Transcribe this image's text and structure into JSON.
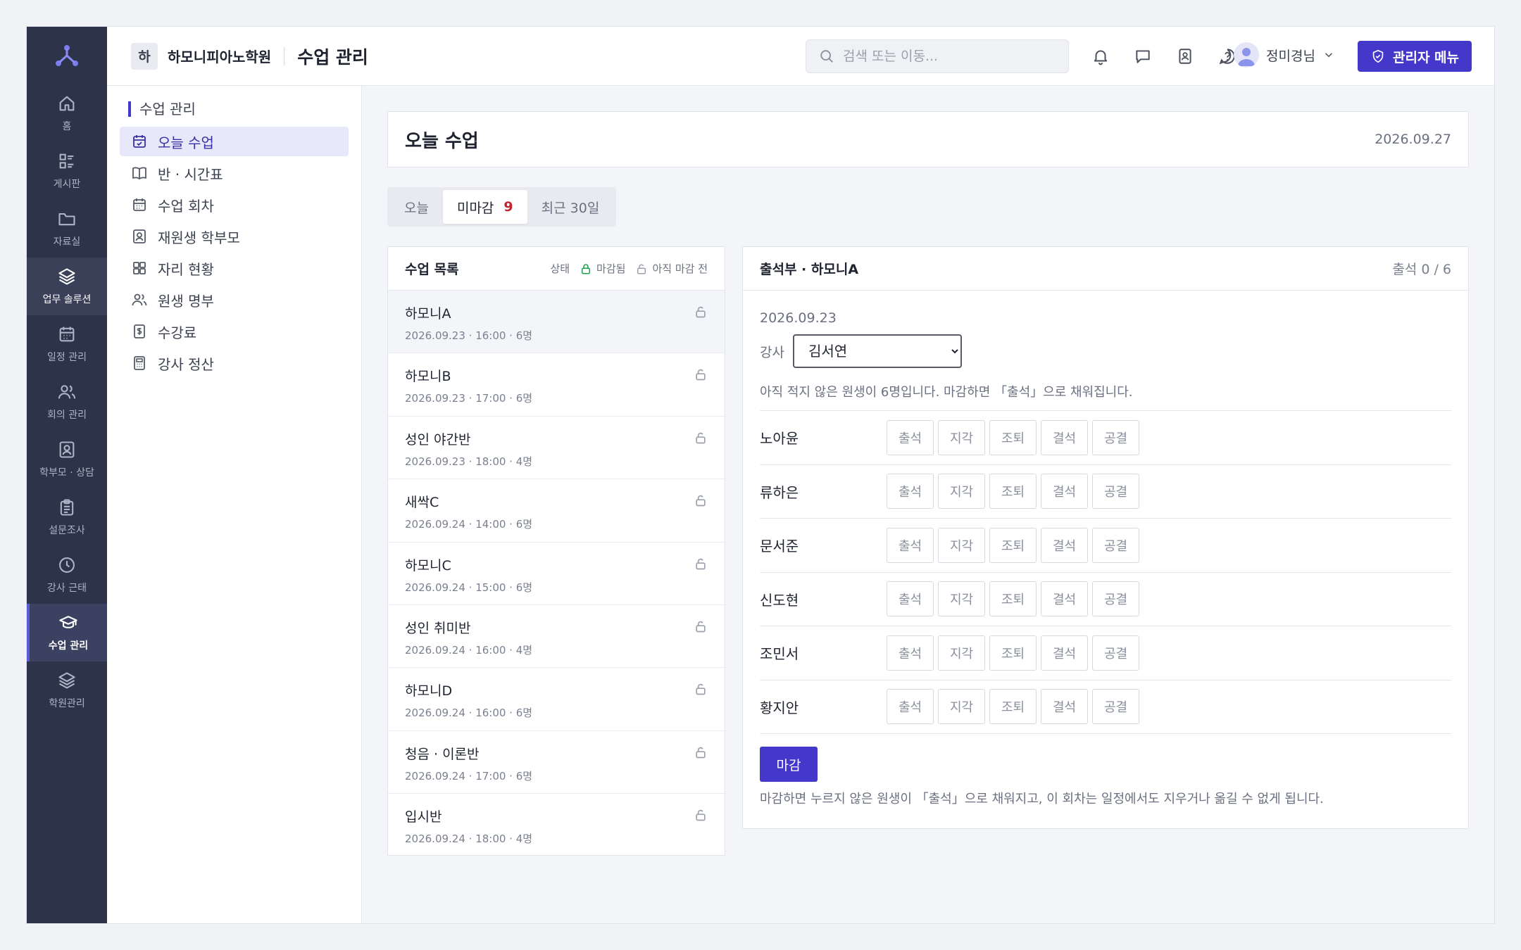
{
  "rail": {
    "items": [
      {
        "label": "홈",
        "icon": "home-icon"
      },
      {
        "label": "게시판",
        "icon": "board-icon"
      },
      {
        "label": "자료실",
        "icon": "folder-icon"
      },
      {
        "label": "업무 솔루션",
        "icon": "layers-icon"
      },
      {
        "label": "일정 관리",
        "icon": "calendar-icon"
      },
      {
        "label": "회의 관리",
        "icon": "users-icon"
      },
      {
        "label": "학부모 · 상담",
        "icon": "contact-icon"
      },
      {
        "label": "설문조사",
        "icon": "clipboard-icon"
      },
      {
        "label": "강사 근태",
        "icon": "clock-icon"
      },
      {
        "label": "수업 관리",
        "icon": "graduation-cap-icon"
      },
      {
        "label": "학원관리",
        "icon": "layers-icon"
      }
    ]
  },
  "topbar": {
    "org_initial": "하",
    "org_name": "하모니피아노학원",
    "page_title": "수업 관리",
    "search_placeholder": "검색 또는 이동...",
    "user_name": "정미경님",
    "admin_button": "관리자 메뉴"
  },
  "subnav": {
    "title": "수업 관리",
    "items": [
      {
        "label": "오늘 수업",
        "icon": "calendar-check-icon"
      },
      {
        "label": "반 · 시간표",
        "icon": "book-icon"
      },
      {
        "label": "수업 회차",
        "icon": "calendar-icon"
      },
      {
        "label": "재원생 학부모",
        "icon": "contact-icon"
      },
      {
        "label": "자리 현황",
        "icon": "grid-icon"
      },
      {
        "label": "원생 명부",
        "icon": "users-icon"
      },
      {
        "label": "수강료",
        "icon": "receipt-icon"
      },
      {
        "label": "강사 정산",
        "icon": "calculator-icon"
      }
    ]
  },
  "main": {
    "title": "오늘 수업",
    "date": "2026.09.27",
    "tabs": [
      {
        "label": "오늘"
      },
      {
        "label": "미마감",
        "count": "9"
      },
      {
        "label": "최근 30일"
      }
    ]
  },
  "class_list": {
    "title": "수업 목록",
    "legend_status": "상태",
    "legend_closed": "마감됨",
    "legend_open": "아직 마감 전",
    "rows": [
      {
        "name": "하모니A",
        "meta": "2026.09.23 · 16:00 · 6명"
      },
      {
        "name": "하모니B",
        "meta": "2026.09.23 · 17:00 · 6명"
      },
      {
        "name": "성인 야간반",
        "meta": "2026.09.23 · 18:00 · 4명"
      },
      {
        "name": "새싹C",
        "meta": "2026.09.24 · 14:00 · 6명"
      },
      {
        "name": "하모니C",
        "meta": "2026.09.24 · 15:00 · 6명"
      },
      {
        "name": "성인 취미반",
        "meta": "2026.09.24 · 16:00 · 4명"
      },
      {
        "name": "하모니D",
        "meta": "2026.09.24 · 16:00 · 6명"
      },
      {
        "name": "청음 · 이론반",
        "meta": "2026.09.24 · 17:00 · 6명"
      },
      {
        "name": "입시반",
        "meta": "2026.09.24 · 18:00 · 4명"
      }
    ]
  },
  "attendance": {
    "title": "출석부 · 하모니A",
    "count": "출석 0 / 6",
    "date": "2026.09.23",
    "teacher_label": "강사",
    "teacher_value": "김서연",
    "notice": "아직 적지 않은 원생이 6명입니다. 마감하면 「출석」으로 채워집니다.",
    "status_options": [
      "출석",
      "지각",
      "조퇴",
      "결석",
      "공결"
    ],
    "students": [
      "노아윤",
      "류하은",
      "문서준",
      "신도현",
      "조민서",
      "황지안"
    ],
    "close_button": "마감",
    "footer_note": "마감하면 누르지 않은 원생이 「출석」으로 채워지고, 이 회차는 일정에서도 지우거나 옮길 수 없게 됩니다."
  },
  "colors": {
    "accent": "#4338ca",
    "rail_bg": "#2d3348",
    "badge_red": "#c0262d"
  }
}
